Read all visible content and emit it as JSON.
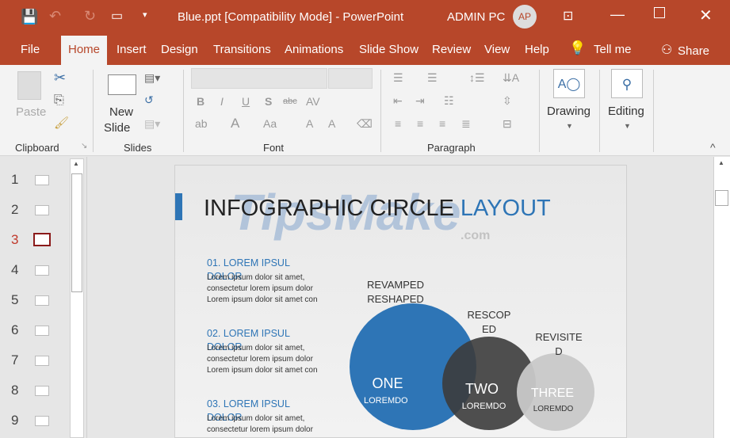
{
  "titlebar": {
    "title": "Blue.ppt [Compatibility Mode]  -  PowerPoint",
    "user": "ADMIN PC",
    "avatar": "AP"
  },
  "tabs": [
    "File",
    "Home",
    "Insert",
    "Design",
    "Transitions",
    "Animations",
    "Slide Show",
    "Review",
    "View",
    "Help"
  ],
  "tell_me": "Tell me",
  "share": "Share",
  "ribbon": {
    "paste": "Paste",
    "new": "New",
    "slide": "Slide",
    "drawing": "Drawing",
    "editing": "Editing",
    "groups": {
      "clipboard": "Clipboard",
      "slides": "Slides",
      "font": "Font",
      "paragraph": "Paragraph"
    }
  },
  "thumbnails": [
    "1",
    "2",
    "3",
    "4",
    "5",
    "6",
    "7",
    "8",
    "9"
  ],
  "selected_slide": 3,
  "slide": {
    "title_a": "INFOGRAPHIC CIRCLE ",
    "title_b": "LAYOUT",
    "watermark": "TipsMake",
    "watermark_suffix": ".com",
    "sections": [
      {
        "heading": "01. LOREM IPSUL",
        "heading2": "DOLOR",
        "l1": "Lorem ipsum dolor sit amet,",
        "l2": "consectetur lorem ipsum dolor",
        "l3": "Lorem ipsum dolor sit amet con"
      },
      {
        "heading": "02. LOREM IPSUL",
        "heading2": "DOLOR",
        "l1": "Lorem ipsum dolor sit amet,",
        "l2": "consectetur lorem ipsum dolor",
        "l3": "Lorem ipsum dolor sit amet con"
      },
      {
        "heading": "03. LOREM IPSUL",
        "heading2": "DOLOR",
        "l1": "Lorem ipsum dolor sit amet,",
        "l2": "consectetur lorem ipsum dolor"
      }
    ],
    "circles": [
      {
        "top1": "REVAMPED",
        "top2": "RESHAPED",
        "big": "ONE",
        "small": "LOREMDO"
      },
      {
        "top1": "RESCOP",
        "top2": "ED",
        "big": "TWO",
        "small": "LOREMDO"
      },
      {
        "top1": "REVISITE",
        "top2": "D",
        "big": "THREE",
        "small": "LOREMDO"
      }
    ]
  }
}
